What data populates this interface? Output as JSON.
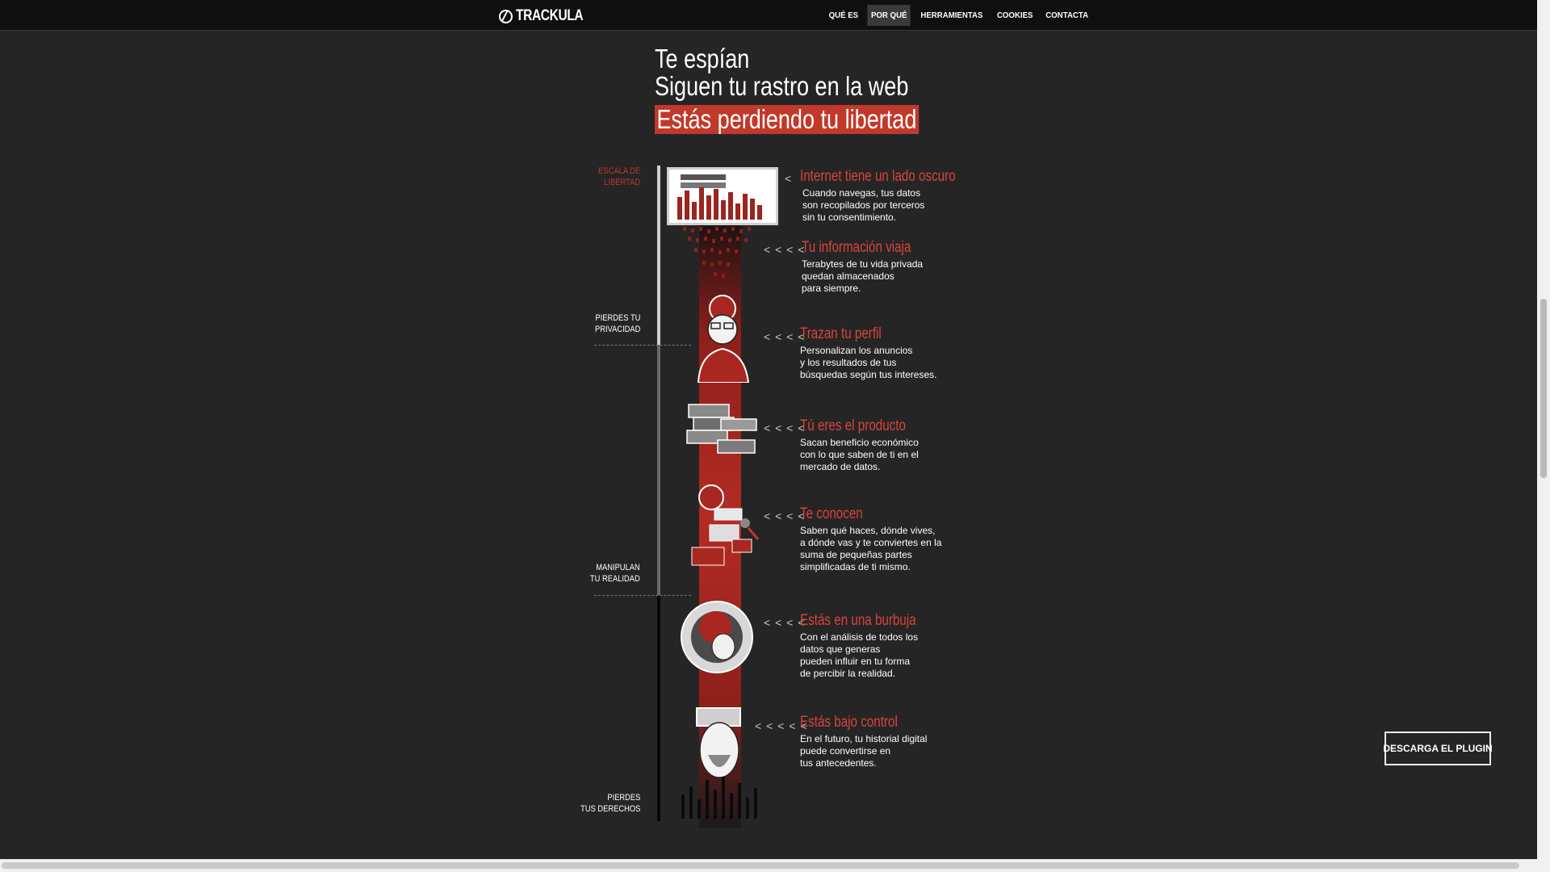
{
  "header": {
    "logo_text": "TRACKULA",
    "nav": [
      {
        "label": "QUÉ ES",
        "active": false
      },
      {
        "label": "POR QUÉ",
        "active": true
      },
      {
        "label": "HERRAMIENTAS",
        "active": false
      },
      {
        "label": "COOKIES",
        "active": false
      },
      {
        "label": "CONTACTA",
        "active": false
      }
    ]
  },
  "hero": {
    "line1": "Te espían",
    "line2": "Siguen tu rastro en la web",
    "highlight": "Estás perdiendo tu libertad"
  },
  "scale": {
    "heading": "ESCALA DE\nLIBERTAD",
    "level1": "PIERDES TU\nPRIVACIDAD",
    "level2": "MANIPULAN\nTU REALIDAD",
    "level3": "PIERDES\nTUS DERECHOS"
  },
  "entries": [
    {
      "title": "Internet tiene un lado oscuro",
      "body": "Cuando navegas, tus datos\nson recopilados por terceros\nsin tu consentimiento.",
      "arrows": "<"
    },
    {
      "title": "Tu información viaja",
      "body": "Terabytes de tu vida privada\nquedan almacenados\npara siempre.",
      "arrows": "< < < <"
    },
    {
      "title": "Trazan tu perfil",
      "body": "Personalizan los anuncios\ny los resultados de tus\nbúsquedas según tus intereses.",
      "arrows": "< < < <"
    },
    {
      "title": "Tú eres el producto",
      "body": "Sacan beneficio económico\ncon lo que saben de ti en el\nmercado de datos.",
      "arrows": "< < < <"
    },
    {
      "title": "Te conocen",
      "body": "Saben qué haces, dónde vives,\na dónde vas y te conviertes en la\nsuma de pequeñas partes\nsimplificadas de ti mismo.",
      "arrows": "< < < <"
    },
    {
      "title": "Estás en una burbuja",
      "body": "Con el análisis de todos los\ndatos que generas\npueden influir en tu forma\nde percibir la realidad.",
      "arrows": "< < < <"
    },
    {
      "title": "Estás bajo control",
      "body": "En el futuro, tu historial digital\npuede convertirse en\ntus antecedentes.",
      "arrows": "< < < < <"
    }
  ],
  "cta": {
    "label": "DESCARGA EL PLUGIN"
  },
  "colors": {
    "accent": "#c0392b",
    "background": "#252525",
    "nav_bg": "#0f0f0f"
  },
  "icons": [
    "logo-icon",
    "browser-data-illustration",
    "person-glasses-illustration",
    "money-stack-illustration",
    "fragmented-person-illustration",
    "bubble-head-illustration",
    "controlled-person-illustration"
  ]
}
